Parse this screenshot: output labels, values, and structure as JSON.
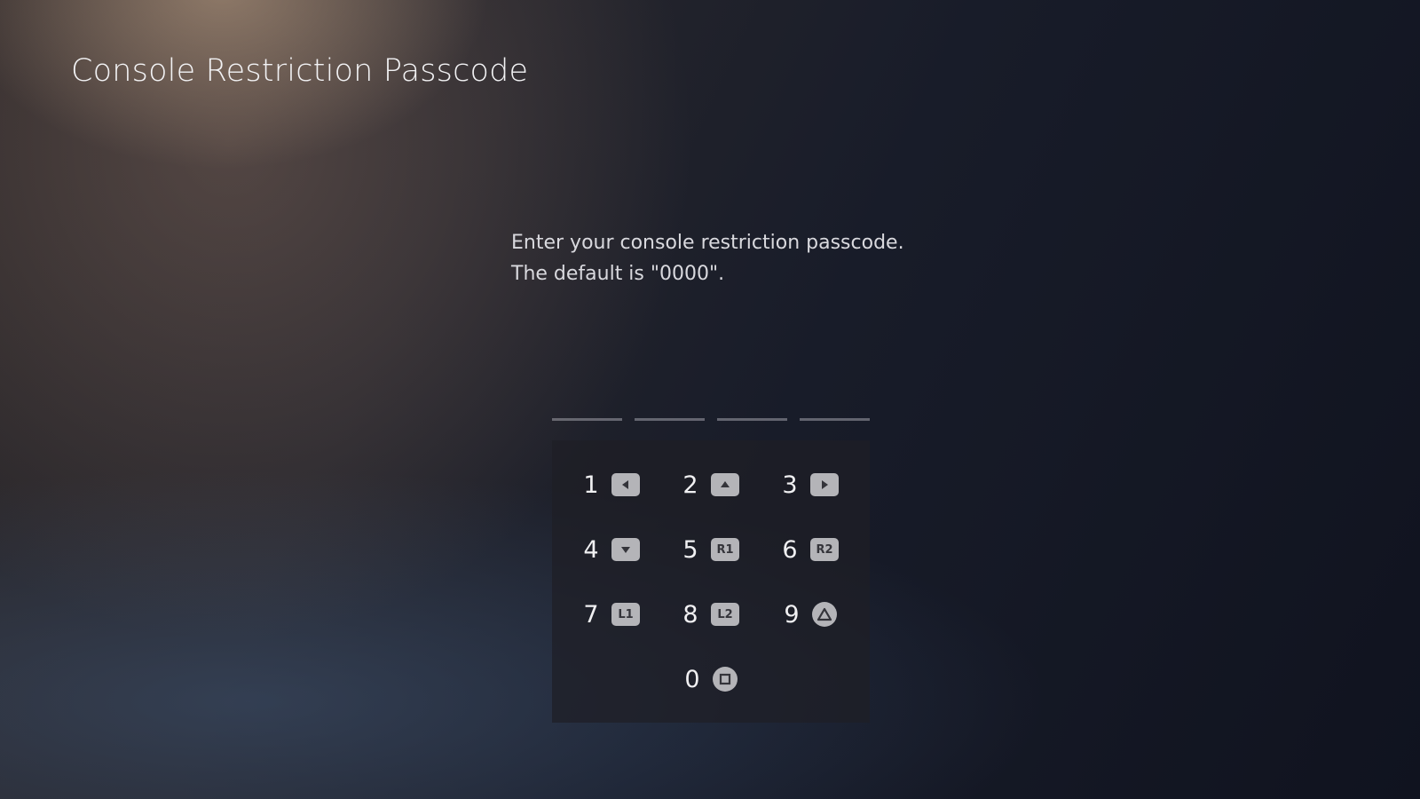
{
  "page": {
    "title": "Console Restriction Passcode",
    "instruction_line1": "Enter your console restriction passcode.",
    "instruction_line2": "The default is \"0000\"."
  },
  "passcode": {
    "digits_entered": 0,
    "length": 4
  },
  "keypad": {
    "keys": [
      {
        "digit": "1",
        "button": "dpad-left",
        "icon": "dpad-left-icon"
      },
      {
        "digit": "2",
        "button": "dpad-up",
        "icon": "dpad-up-icon"
      },
      {
        "digit": "3",
        "button": "dpad-right",
        "icon": "dpad-right-icon"
      },
      {
        "digit": "4",
        "button": "dpad-down",
        "icon": "dpad-down-icon"
      },
      {
        "digit": "5",
        "button_label": "R1",
        "icon": "r1-button-icon"
      },
      {
        "digit": "6",
        "button_label": "R2",
        "icon": "r2-button-icon"
      },
      {
        "digit": "7",
        "button_label": "L1",
        "icon": "l1-button-icon"
      },
      {
        "digit": "8",
        "button_label": "L2",
        "icon": "l2-button-icon"
      },
      {
        "digit": "9",
        "button": "triangle",
        "icon": "triangle-button-icon"
      },
      {
        "digit": "0",
        "button": "square",
        "icon": "square-button-icon"
      }
    ]
  },
  "colors": {
    "background": "#121623",
    "text": "#e8e8ec",
    "badge": "#b4b4b8"
  }
}
